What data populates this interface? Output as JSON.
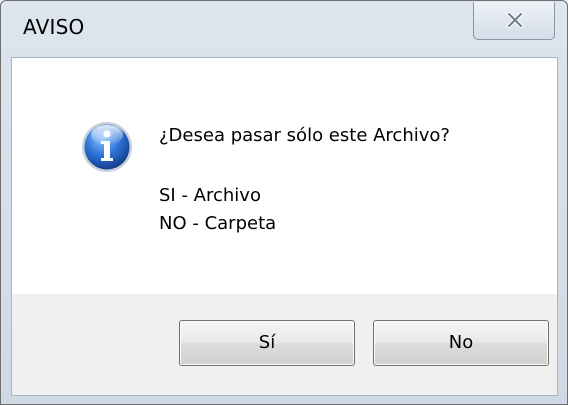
{
  "window": {
    "title": "AVISO",
    "close_label": "close"
  },
  "message": {
    "question": "¿Desea pasar sólo este Archivo?",
    "option_si": "SI - Archivo",
    "option_no": "NO - Carpeta",
    "icon": "info-icon"
  },
  "buttons": {
    "yes_label": "Sí",
    "no_label": "No"
  },
  "colors": {
    "icon_blue": "#1f5fb8",
    "dialog_background": "#f0f0f0",
    "message_background": "#ffffff"
  }
}
